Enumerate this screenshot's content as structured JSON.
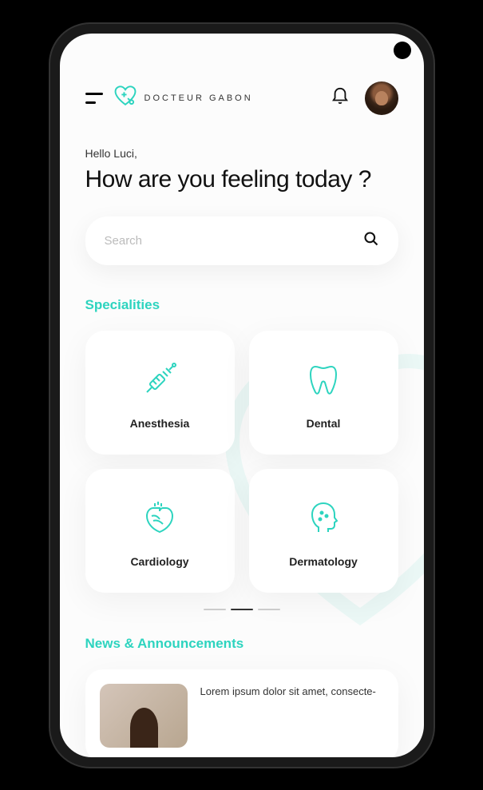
{
  "header": {
    "brand": "DOCTEUR GABON"
  },
  "greeting": "Hello Luci,",
  "question": "How are you feeling today ?",
  "search": {
    "placeholder": "Search"
  },
  "sections": {
    "specialities_title": "Specialities",
    "news_title": "News & Announcements"
  },
  "specialities": [
    {
      "label": "Anesthesia",
      "icon": "syringe"
    },
    {
      "label": "Dental",
      "icon": "tooth"
    },
    {
      "label": "Cardiology",
      "icon": "heart"
    },
    {
      "label": "Dermatology",
      "icon": "head"
    }
  ],
  "news": {
    "text": "Lorem ipsum dolor sit amet, consecte-"
  },
  "colors": {
    "accent": "#2dd4bf"
  }
}
